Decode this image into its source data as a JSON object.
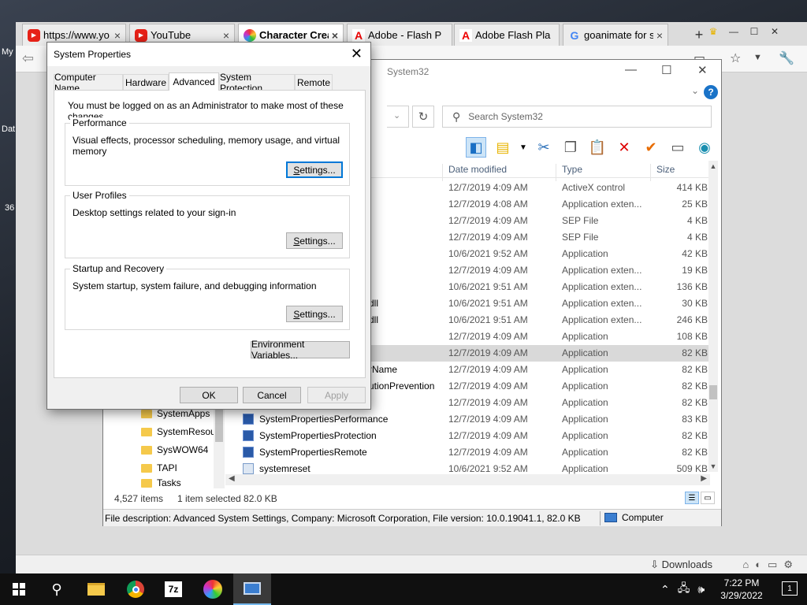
{
  "browser": {
    "tabs": [
      {
        "label": "https://www.yo",
        "icon": "youtube-icon"
      },
      {
        "label": "YouTube",
        "icon": "youtube-icon"
      },
      {
        "label": "Character Crea",
        "icon": "colorful-icon"
      },
      {
        "label": "Adobe - Flash P",
        "icon": "adobe-icon"
      },
      {
        "label": "Adobe Flash Pla",
        "icon": "adobe-icon"
      },
      {
        "label": "goanimate for s",
        "icon": "google-icon"
      }
    ],
    "downloads_label": "Downloads"
  },
  "desktop": {
    "labels": [
      "My",
      "Dat",
      "36"
    ]
  },
  "explorer": {
    "title": "System32",
    "search_placeholder": "Search System32",
    "columns": [
      "Date modified",
      "Type",
      "Size"
    ],
    "rows": [
      {
        "name": "",
        "date": "12/7/2019 4:09 AM",
        "type": "ActiveX control",
        "size": "414 KB"
      },
      {
        "name": "",
        "date": "12/7/2019 4:08 AM",
        "type": "Application exten...",
        "size": "25 KB"
      },
      {
        "name": "",
        "date": "12/7/2019 4:09 AM",
        "type": "SEP File",
        "size": "4 KB"
      },
      {
        "name": "",
        "date": "12/7/2019 4:09 AM",
        "type": "SEP File",
        "size": "4 KB"
      },
      {
        "name": "",
        "date": "10/6/2021 9:52 AM",
        "type": "Application",
        "size": "42 KB"
      },
      {
        "name": "",
        "date": "12/7/2019 4:09 AM",
        "type": "Application exten...",
        "size": "19 KB"
      },
      {
        "name": "",
        "date": "10/6/2021 9:51 AM",
        "type": "Application exten...",
        "size": "136 KB"
      },
      {
        "name": "dll",
        "date": "10/6/2021 9:51 AM",
        "type": "Application exten...",
        "size": "30 KB"
      },
      {
        "name": "dll",
        "date": "10/6/2021 9:51 AM",
        "type": "Application exten...",
        "size": "246 KB"
      },
      {
        "name": "",
        "date": "12/7/2019 4:09 AM",
        "type": "Application",
        "size": "108 KB"
      },
      {
        "name": "",
        "date": "12/7/2019 4:09 AM",
        "type": "Application",
        "size": "82 KB"
      },
      {
        "name": "rName",
        "date": "12/7/2019 4:09 AM",
        "type": "Application",
        "size": "82 KB"
      },
      {
        "name": "utionPrevention",
        "date": "12/7/2019 4:09 AM",
        "type": "Application",
        "size": "82 KB"
      },
      {
        "name": "",
        "date": "12/7/2019 4:09 AM",
        "type": "Application",
        "size": "82 KB"
      },
      {
        "name": "SystemPropertiesPerformance",
        "date": "12/7/2019 4:09 AM",
        "type": "Application",
        "size": "83 KB"
      },
      {
        "name": "SystemPropertiesProtection",
        "date": "12/7/2019 4:09 AM",
        "type": "Application",
        "size": "82 KB"
      },
      {
        "name": "SystemPropertiesRemote",
        "date": "12/7/2019 4:09 AM",
        "type": "Application",
        "size": "82 KB"
      },
      {
        "name": "systemreset",
        "date": "10/6/2021 9:52 AM",
        "type": "Application",
        "size": "509 KB"
      }
    ],
    "nav_items": [
      "SystemApps",
      "SystemResou",
      "SysWOW64",
      "TAPI",
      "Tasks"
    ],
    "status_items": "4,527 items",
    "status_selected": "1 item selected  82.0 KB",
    "description": "File description: Advanced System Settings, Company: Microsoft Corporation, File version: 10.0.19041.1, 82.0 KB",
    "computer_label": "Computer"
  },
  "dialog": {
    "title": "System Properties",
    "tabs": [
      "Computer Name",
      "Hardware",
      "Advanced",
      "System Protection",
      "Remote"
    ],
    "active_tab": "Advanced",
    "notice": "You must be logged on as an Administrator to make most of these changes.",
    "performance": {
      "title": "Performance",
      "desc": "Visual effects, processor scheduling, memory usage, and virtual memory"
    },
    "profiles": {
      "title": "User Profiles",
      "desc": "Desktop settings related to your sign-in"
    },
    "startup": {
      "title": "Startup and Recovery",
      "desc": "System startup, system failure, and debugging information"
    },
    "settings_label": "Settings...",
    "env_label": "Environment Variables...",
    "ok_label": "OK",
    "cancel_label": "Cancel",
    "apply_label": "Apply"
  },
  "taskbar": {
    "time": "7:22 PM",
    "date": "3/29/2022",
    "notification_count": "1"
  }
}
